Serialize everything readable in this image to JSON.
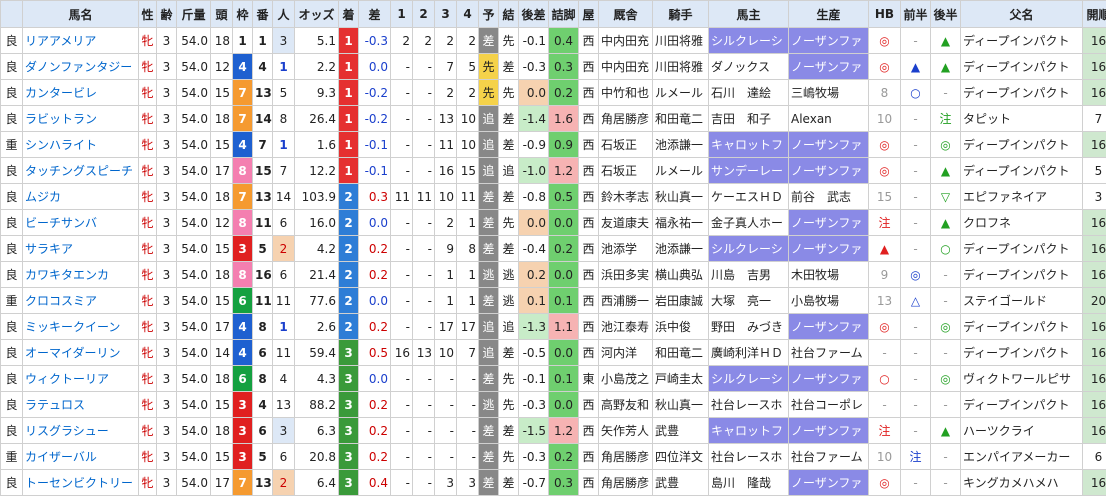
{
  "headers": [
    "馬名",
    "性",
    "齢",
    "斤量",
    "頭",
    "枠",
    "番",
    "人",
    "オッズ",
    "着",
    "差",
    "1",
    "2",
    "3",
    "4",
    "予",
    "結",
    "後差",
    "詰脚",
    "屋",
    "厩舎",
    "騎手",
    "馬主",
    "生産",
    "HB",
    "前半",
    "後半",
    "父名",
    "開順"
  ],
  "rows": [
    {
      "baba": "良",
      "name": "リアアメリア",
      "sex": "牝",
      "age": "3",
      "kinryo": "54.0",
      "tosu": "18",
      "waku": "1",
      "umaban": "1",
      "ninki": "3",
      "odds": "5.1",
      "chaku": "1",
      "sa": "-0.3",
      "p1": "2",
      "p2": "2",
      "p3": "2",
      "p4": "2",
      "yoso": "差",
      "kekka": "先",
      "atosa": "-0.1",
      "tsume": "0.4",
      "ya": "西",
      "kyusha": "中内田充",
      "kishu": "川田将雅",
      "owner": "シルクレーシ",
      "breeder": "ノーザンファ",
      "hb": "◎",
      "zen": "-",
      "kou": "▲",
      "sire": "ディープインパクト",
      "kaijun": "16"
    },
    {
      "baba": "良",
      "name": "ダノンファンタジー",
      "sex": "牝",
      "age": "3",
      "kinryo": "54.0",
      "tosu": "12",
      "waku": "4",
      "umaban": "4",
      "ninki": "1",
      "odds": "2.2",
      "chaku": "1",
      "sa": "0.0",
      "p1": "-",
      "p2": "-",
      "p3": "7",
      "p4": "5",
      "yoso": "先",
      "kekka": "差",
      "atosa": "-0.3",
      "tsume": "0.3",
      "ya": "西",
      "kyusha": "中内田充",
      "kishu": "川田将雅",
      "owner": "ダノックス",
      "breeder": "ノーザンファ",
      "hb": "◎",
      "zen": "▲",
      "kou": "▲",
      "sire": "ディープインパクト",
      "kaijun": "16"
    },
    {
      "baba": "良",
      "name": "カンタービレ",
      "sex": "牝",
      "age": "3",
      "kinryo": "54.0",
      "tosu": "15",
      "waku": "7",
      "umaban": "13",
      "ninki": "5",
      "odds": "9.3",
      "chaku": "1",
      "sa": "-0.2",
      "p1": "-",
      "p2": "-",
      "p3": "2",
      "p4": "2",
      "yoso": "先",
      "kekka": "先",
      "atosa": "0.0",
      "tsume": "0.2",
      "ya": "西",
      "kyusha": "中竹和也",
      "kishu": "ルメール",
      "owner": "石川　達絵",
      "breeder": "三嶋牧場",
      "hb": "8",
      "zen": "○",
      "kou": "-",
      "sire": "ディープインパクト",
      "kaijun": "16"
    },
    {
      "baba": "良",
      "name": "ラビットラン",
      "sex": "牝",
      "age": "3",
      "kinryo": "54.0",
      "tosu": "18",
      "waku": "7",
      "umaban": "14",
      "ninki": "8",
      "odds": "26.4",
      "chaku": "1",
      "sa": "-0.2",
      "p1": "-",
      "p2": "-",
      "p3": "13",
      "p4": "10",
      "yoso": "追",
      "kekka": "差",
      "atosa": "-1.4",
      "tsume": "1.6",
      "ya": "西",
      "kyusha": "角居勝彦",
      "kishu": "和田竜二",
      "owner": "吉田　和子",
      "breeder": "Alexan",
      "hb": "10",
      "zen": "-",
      "kou": "注",
      "sire": "タピット",
      "kaijun": "7"
    },
    {
      "baba": "重",
      "name": "シンハライト",
      "sex": "牝",
      "age": "3",
      "kinryo": "54.0",
      "tosu": "15",
      "waku": "4",
      "umaban": "7",
      "ninki": "1",
      "odds": "1.6",
      "chaku": "1",
      "sa": "-0.1",
      "p1": "-",
      "p2": "-",
      "p3": "11",
      "p4": "10",
      "yoso": "追",
      "kekka": "差",
      "atosa": "-0.9",
      "tsume": "0.9",
      "ya": "西",
      "kyusha": "石坂正",
      "kishu": "池添謙一",
      "owner": "キャロットフ",
      "breeder": "ノーザンファ",
      "hb": "◎",
      "zen": "-",
      "kou": "◎",
      "sire": "ディープインパクト",
      "kaijun": "16"
    },
    {
      "baba": "良",
      "name": "タッチングスピーチ",
      "sex": "牝",
      "age": "3",
      "kinryo": "54.0",
      "tosu": "17",
      "waku": "8",
      "umaban": "15",
      "ninki": "7",
      "odds": "12.2",
      "chaku": "1",
      "sa": "-0.1",
      "p1": "-",
      "p2": "-",
      "p3": "16",
      "p4": "15",
      "yoso": "追",
      "kekka": "追",
      "atosa": "-1.0",
      "tsume": "1.2",
      "ya": "西",
      "kyusha": "石坂正",
      "kishu": "ルメール",
      "owner": "サンデーレー",
      "breeder": "ノーザンファ",
      "hb": "◎",
      "zen": "-",
      "kou": "▲",
      "sire": "ディープインパクト",
      "kaijun": "5"
    },
    {
      "baba": "良",
      "name": "ムジカ",
      "sex": "牝",
      "age": "3",
      "kinryo": "54.0",
      "tosu": "18",
      "waku": "7",
      "umaban": "13",
      "ninki": "14",
      "odds": "103.9",
      "chaku": "2",
      "sa": "0.3",
      "p1": "11",
      "p2": "11",
      "p3": "10",
      "p4": "11",
      "yoso": "差",
      "kekka": "差",
      "atosa": "-0.8",
      "tsume": "0.5",
      "ya": "西",
      "kyusha": "鈴木孝志",
      "kishu": "秋山真一",
      "owner": "ケーエスＨＤ",
      "breeder": "前谷　武志",
      "hb": "15",
      "zen": "-",
      "kou": "▽",
      "sire": "エピファネイア",
      "kaijun": "3"
    },
    {
      "baba": "良",
      "name": "ビーチサンバ",
      "sex": "牝",
      "age": "3",
      "kinryo": "54.0",
      "tosu": "12",
      "waku": "8",
      "umaban": "11",
      "ninki": "6",
      "odds": "16.0",
      "chaku": "2",
      "sa": "0.0",
      "p1": "-",
      "p2": "-",
      "p3": "2",
      "p4": "1",
      "yoso": "差",
      "kekka": "先",
      "atosa": "0.0",
      "tsume": "0.0",
      "ya": "西",
      "kyusha": "友道康夫",
      "kishu": "福永祐一",
      "owner": "金子真人ホー",
      "breeder": "ノーザンファ",
      "hb": "注",
      "zen": "-",
      "kou": "▲",
      "sire": "クロフネ",
      "kaijun": "16"
    },
    {
      "baba": "良",
      "name": "サラキア",
      "sex": "牝",
      "age": "3",
      "kinryo": "54.0",
      "tosu": "15",
      "waku": "3",
      "umaban": "5",
      "ninki": "2",
      "odds": "4.2",
      "chaku": "2",
      "sa": "0.2",
      "p1": "-",
      "p2": "-",
      "p3": "9",
      "p4": "8",
      "yoso": "差",
      "kekka": "差",
      "atosa": "-0.4",
      "tsume": "0.2",
      "ya": "西",
      "kyusha": "池添学",
      "kishu": "池添謙一",
      "owner": "シルクレーシ",
      "breeder": "ノーザンファ",
      "hb": "▲",
      "zen": "-",
      "kou": "○",
      "sire": "ディープインパクト",
      "kaijun": "16"
    },
    {
      "baba": "良",
      "name": "カワキタエンカ",
      "sex": "牝",
      "age": "3",
      "kinryo": "54.0",
      "tosu": "18",
      "waku": "8",
      "umaban": "16",
      "ninki": "6",
      "odds": "21.4",
      "chaku": "2",
      "sa": "0.2",
      "p1": "-",
      "p2": "-",
      "p3": "1",
      "p4": "1",
      "yoso": "逃",
      "kekka": "逃",
      "atosa": "0.2",
      "tsume": "0.0",
      "ya": "西",
      "kyusha": "浜田多実",
      "kishu": "横山典弘",
      "owner": "川島　吉男",
      "breeder": "木田牧場",
      "hb": "9",
      "zen": "◎",
      "kou": "-",
      "sire": "ディープインパクト",
      "kaijun": "16"
    },
    {
      "baba": "重",
      "name": "クロコスミア",
      "sex": "牝",
      "age": "3",
      "kinryo": "54.0",
      "tosu": "15",
      "waku": "6",
      "umaban": "11",
      "ninki": "11",
      "odds": "77.6",
      "chaku": "2",
      "sa": "0.0",
      "p1": "-",
      "p2": "-",
      "p3": "1",
      "p4": "1",
      "yoso": "差",
      "kekka": "逃",
      "atosa": "0.1",
      "tsume": "0.1",
      "ya": "西",
      "kyusha": "西浦勝一",
      "kishu": "岩田康誠",
      "owner": "大塚　亮一",
      "breeder": "小島牧場",
      "hb": "13",
      "zen": "△",
      "kou": "-",
      "sire": "ステイゴールド",
      "kaijun": "20"
    },
    {
      "baba": "良",
      "name": "ミッキークイーン",
      "sex": "牝",
      "age": "3",
      "kinryo": "54.0",
      "tosu": "17",
      "waku": "4",
      "umaban": "8",
      "ninki": "1",
      "odds": "2.6",
      "chaku": "2",
      "sa": "0.2",
      "p1": "-",
      "p2": "-",
      "p3": "17",
      "p4": "17",
      "yoso": "追",
      "kekka": "追",
      "atosa": "-1.3",
      "tsume": "1.1",
      "ya": "西",
      "kyusha": "池江泰寿",
      "kishu": "浜中俊",
      "owner": "野田　みづき",
      "breeder": "ノーザンファ",
      "hb": "◎",
      "zen": "-",
      "kou": "◎",
      "sire": "ディープインパクト",
      "kaijun": "16"
    },
    {
      "baba": "良",
      "name": "オーマイダーリン",
      "sex": "牝",
      "age": "3",
      "kinryo": "54.0",
      "tosu": "14",
      "waku": "4",
      "umaban": "6",
      "ninki": "11",
      "odds": "59.4",
      "chaku": "3",
      "sa": "0.5",
      "p1": "16",
      "p2": "13",
      "p3": "10",
      "p4": "7",
      "yoso": "追",
      "kekka": "差",
      "atosa": "-0.5",
      "tsume": "0.0",
      "ya": "西",
      "kyusha": "河内洋",
      "kishu": "和田竜二",
      "owner": "廣崎利洋ＨＤ",
      "breeder": "社台ファーム",
      "hb": "-",
      "zen": "-",
      "kou": "-",
      "sire": "ディープインパクト",
      "kaijun": "16"
    },
    {
      "baba": "良",
      "name": "ウィクトーリア",
      "sex": "牝",
      "age": "3",
      "kinryo": "54.0",
      "tosu": "18",
      "waku": "6",
      "umaban": "8",
      "ninki": "4",
      "odds": "4.3",
      "chaku": "3",
      "sa": "0.0",
      "p1": "-",
      "p2": "-",
      "p3": "-",
      "p4": "-",
      "yoso": "差",
      "kekka": "先",
      "atosa": "-0.1",
      "tsume": "0.1",
      "ya": "東",
      "kyusha": "小島茂之",
      "kishu": "戸崎圭太",
      "owner": "シルクレーシ",
      "breeder": "ノーザンファ",
      "hb": "○",
      "zen": "-",
      "kou": "◎",
      "sire": "ヴィクトワールピサ",
      "kaijun": "16"
    },
    {
      "baba": "良",
      "name": "ラテュロス",
      "sex": "牝",
      "age": "3",
      "kinryo": "54.0",
      "tosu": "15",
      "waku": "3",
      "umaban": "4",
      "ninki": "13",
      "odds": "88.2",
      "chaku": "3",
      "sa": "0.2",
      "p1": "-",
      "p2": "-",
      "p3": "-",
      "p4": "-",
      "yoso": "逃",
      "kekka": "先",
      "atosa": "-0.3",
      "tsume": "0.0",
      "ya": "西",
      "kyusha": "高野友和",
      "kishu": "秋山真一",
      "owner": "社台レースホ",
      "breeder": "社台コーポレ",
      "hb": "-",
      "zen": "-",
      "kou": "-",
      "sire": "ディープインパクト",
      "kaijun": "16"
    },
    {
      "baba": "良",
      "name": "リスグラシュー",
      "sex": "牝",
      "age": "3",
      "kinryo": "54.0",
      "tosu": "18",
      "waku": "3",
      "umaban": "6",
      "ninki": "3",
      "odds": "6.3",
      "chaku": "3",
      "sa": "0.2",
      "p1": "-",
      "p2": "-",
      "p3": "-",
      "p4": "-",
      "yoso": "差",
      "kekka": "差",
      "atosa": "-1.5",
      "tsume": "1.2",
      "ya": "西",
      "kyusha": "矢作芳人",
      "kishu": "武豊",
      "owner": "キャロットフ",
      "breeder": "ノーザンファ",
      "hb": "注",
      "zen": "-",
      "kou": "▲",
      "sire": "ハーツクライ",
      "kaijun": "16"
    },
    {
      "baba": "重",
      "name": "カイザーバル",
      "sex": "牝",
      "age": "3",
      "kinryo": "54.0",
      "tosu": "15",
      "waku": "3",
      "umaban": "5",
      "ninki": "6",
      "odds": "20.8",
      "chaku": "3",
      "sa": "0.2",
      "p1": "-",
      "p2": "-",
      "p3": "-",
      "p4": "-",
      "yoso": "差",
      "kekka": "先",
      "atosa": "-0.3",
      "tsume": "0.2",
      "ya": "西",
      "kyusha": "角居勝彦",
      "kishu": "四位洋文",
      "owner": "社台レースホ",
      "breeder": "社台ファーム",
      "hb": "10",
      "zen": "注",
      "kou": "-",
      "sire": "エンパイアメーカー",
      "kaijun": "6"
    },
    {
      "baba": "良",
      "name": "トーセンビクトリー",
      "sex": "牝",
      "age": "3",
      "kinryo": "54.0",
      "tosu": "17",
      "waku": "7",
      "umaban": "13",
      "ninki": "2",
      "odds": "6.4",
      "chaku": "3",
      "sa": "0.4",
      "p1": "-",
      "p2": "-",
      "p3": "3",
      "p4": "3",
      "yoso": "差",
      "kekka": "差",
      "atosa": "-0.7",
      "tsume": "0.3",
      "ya": "西",
      "kyusha": "角居勝彦",
      "kishu": "武豊",
      "owner": "島川　隆哉",
      "breeder": "ノーザンファ",
      "hb": "◎",
      "zen": "-",
      "kou": "-",
      "sire": "キングカメハメハ",
      "kaijun": "16"
    }
  ],
  "colors": {
    "header_bg": "#dde8f6",
    "waku1": "#ffffff",
    "waku2": "#000000",
    "waku3": "#e02020",
    "waku4": "#1e60d0",
    "waku5": "#f2d000",
    "waku6": "#14a040",
    "waku7": "#f59a30",
    "waku8": "#f47fb0",
    "rank1": "#e53030",
    "rank2": "#2e7dd6",
    "rank3": "#3a9a3a",
    "owner_hl": "#8a8ae6"
  }
}
